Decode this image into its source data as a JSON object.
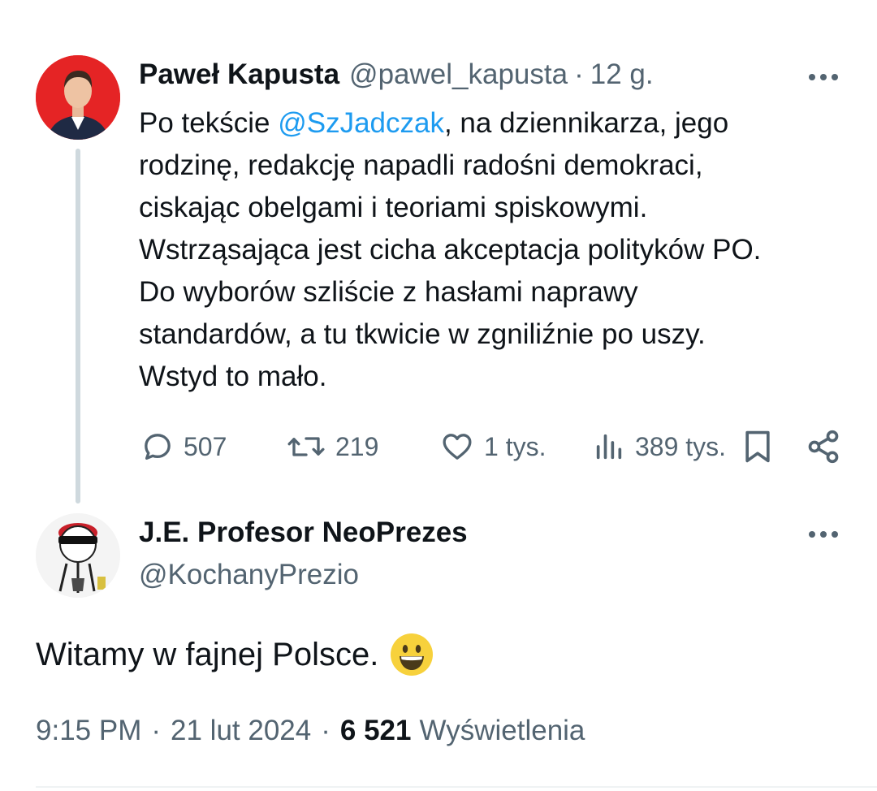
{
  "parent_tweet": {
    "author": {
      "display_name": "Paweł Kapusta",
      "handle": "@pawel_kapusta",
      "separator": "·",
      "time_ago": "12 g."
    },
    "text_before_mention": "Po tekście ",
    "mention": "@SzJadczak",
    "text_after_mention": ", na dziennikarza, jego\nrodzinę, redakcję napadli radośni demokraci,\nciskając obelgami i teoriami spiskowymi.\nWstrząsająca jest cicha akceptacja polityków PO.\nDo wyborów szliście z hasłami naprawy\nstandardów, a tu tkwicie w zgniliźnie po uszy.\nWstyd to mało.",
    "stats": {
      "replies": "507",
      "retweets": "219",
      "likes": "1 tys.",
      "views": "389 tys."
    },
    "icons": {
      "reply": "reply-icon",
      "retweet": "retweet-icon",
      "like": "heart-icon",
      "views": "views-chart-icon",
      "bookmark": "bookmark-icon",
      "share": "share-icon",
      "more": "more-icon"
    }
  },
  "reply_tweet": {
    "author": {
      "display_name": "J.E. Profesor NeoPrezes",
      "handle": "@KochanyPrezio"
    },
    "text": "Witamy w fajnej Polsce.",
    "emoji": "smiling-face-emoji",
    "meta": {
      "time": "9:15 PM",
      "separator": "·",
      "date": "21 lut 2024",
      "views_count": "6 521",
      "views_label": "Wyświetlenia"
    }
  },
  "colors": {
    "text_primary": "#0f1419",
    "text_secondary": "#536471",
    "mention": "#1d9bf0",
    "thread_line": "#cfd9de",
    "avatar_parent_bg": "#e52425"
  }
}
